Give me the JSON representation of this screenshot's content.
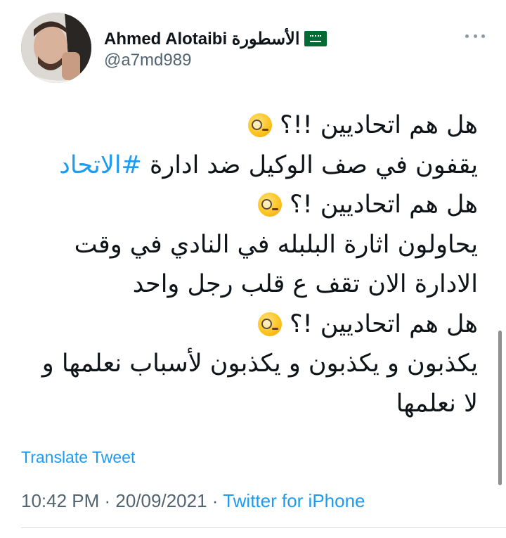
{
  "author": {
    "display_name": "Ahmed Alotaibi الأسطورة",
    "handle": "@a7md989",
    "flag_icon": "saudi-arabia-flag-icon",
    "avatar_icon": "user-avatar"
  },
  "menu": {
    "more_icon": "more-horizontal-icon"
  },
  "tweet": {
    "line_1": "هل هم اتحاديين !!؟",
    "line_2_text": "يقفون في صف الوكيل ضد ادارة ",
    "line_2_hashtag": "#الاتحاد",
    "line_3": "هل هم اتحاديين !؟",
    "line_4": "يحاولون اثارة البلبله في النادي في وقت",
    "line_5": "الادارة الان تقف ع قلب رجل واحد",
    "line_6": "هل هم اتحاديين !؟",
    "line_7": "يكذبون و يكذبون و يكذبون لأسباب نعلمها و",
    "line_8": "لا نعلمها",
    "emoji_icon": "face-with-monocle-icon"
  },
  "translate_label": "Translate Tweet",
  "meta": {
    "time": "10:42 PM",
    "separator": " · ",
    "date": "20/09/2021",
    "source": "Twitter for iPhone"
  },
  "colors": {
    "link": "#1d9bf0",
    "secondary_text": "#536471",
    "primary_text": "#0f1419",
    "divider": "#d6dbe0"
  }
}
